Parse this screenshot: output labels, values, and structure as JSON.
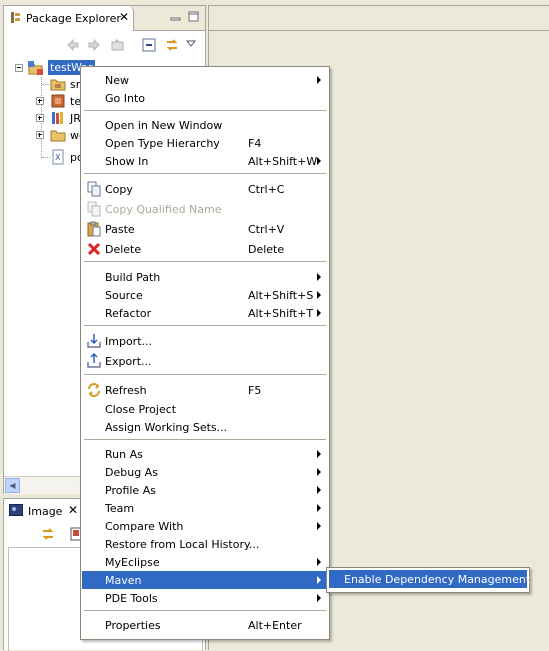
{
  "package_explorer": {
    "title": "Package Explorer",
    "tree": [
      {
        "label": "testWar",
        "icon": "web-project-icon",
        "expanded": true,
        "selected": true
      },
      {
        "label": "src",
        "icon": "source-folder-icon"
      },
      {
        "label": "tes",
        "icon": "package-icon"
      },
      {
        "label": "JR",
        "icon": "library-icon"
      },
      {
        "label": "we",
        "icon": "folder-icon"
      },
      {
        "label": "po",
        "icon": "xml-file-icon"
      }
    ]
  },
  "image_view": {
    "title": "Image"
  },
  "context_menu": {
    "items": {
      "new": {
        "label": "New"
      },
      "go_into": {
        "label": "Go Into"
      },
      "open_new_window": {
        "label": "Open in New Window"
      },
      "open_type_hierarchy": {
        "label": "Open Type Hierarchy",
        "shortcut": "F4"
      },
      "show_in": {
        "label": "Show In",
        "shortcut": "Alt+Shift+W"
      },
      "copy": {
        "label": "Copy",
        "shortcut": "Ctrl+C"
      },
      "copy_qualified_name": {
        "label": "Copy Qualified Name"
      },
      "paste": {
        "label": "Paste",
        "shortcut": "Ctrl+V"
      },
      "delete": {
        "label": "Delete",
        "shortcut": "Delete"
      },
      "build_path": {
        "label": "Build Path"
      },
      "source": {
        "label": "Source",
        "shortcut": "Alt+Shift+S"
      },
      "refactor": {
        "label": "Refactor",
        "shortcut": "Alt+Shift+T"
      },
      "import": {
        "label": "Import..."
      },
      "export": {
        "label": "Export..."
      },
      "refresh": {
        "label": "Refresh",
        "shortcut": "F5"
      },
      "close_project": {
        "label": "Close Project"
      },
      "assign_working_sets": {
        "label": "Assign Working Sets..."
      },
      "run_as": {
        "label": "Run As"
      },
      "debug_as": {
        "label": "Debug As"
      },
      "profile_as": {
        "label": "Profile As"
      },
      "team": {
        "label": "Team"
      },
      "compare_with": {
        "label": "Compare With"
      },
      "restore_history": {
        "label": "Restore from Local History..."
      },
      "myeclipse": {
        "label": "MyEclipse"
      },
      "maven": {
        "label": "Maven"
      },
      "pde_tools": {
        "label": "PDE Tools"
      },
      "properties": {
        "label": "Properties",
        "shortcut": "Alt+Enter"
      }
    }
  },
  "maven_submenu": {
    "items": [
      {
        "label": "Enable Dependency Management"
      }
    ]
  },
  "colors": {
    "selection": "#316ac5",
    "chrome": "#ece9d8",
    "disabled_text": "#aca899"
  }
}
